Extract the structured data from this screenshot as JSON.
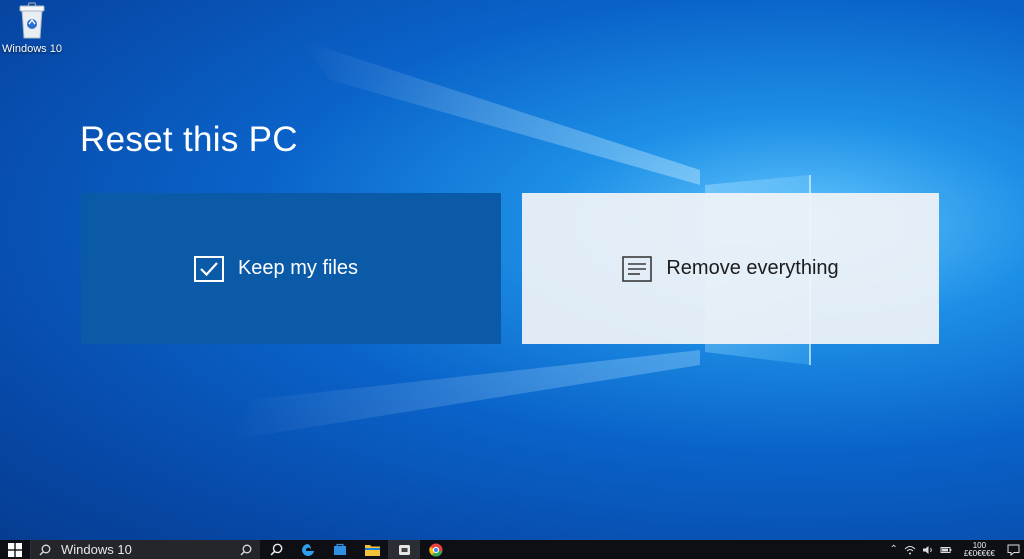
{
  "desktop": {
    "icon_name": "recycle-bin-icon",
    "icon_label": "Windows 10"
  },
  "dialog": {
    "title": "Reset this PC",
    "options": [
      {
        "label": "Keep my files",
        "icon": "checkbox-checked-icon"
      },
      {
        "label": "Remove everything",
        "icon": "document-lines-icon"
      }
    ]
  },
  "taskbar": {
    "search_text": "Windows 10",
    "clock_time": "100",
    "clock_date": "£€0€€€€"
  },
  "colors": {
    "keep_tile": "#0a5aa8",
    "remove_tile": "#f0f3f7",
    "taskbar": "#0d0f14"
  }
}
